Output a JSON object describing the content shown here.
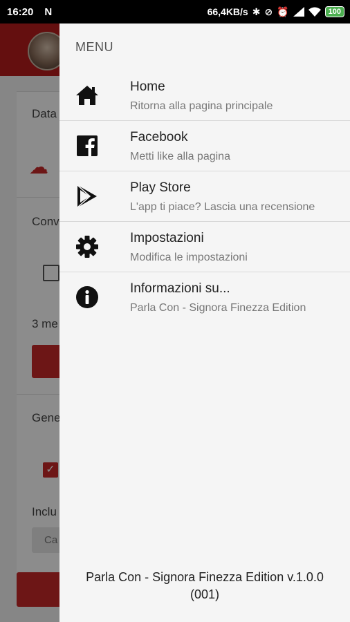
{
  "status_bar": {
    "time": "16:20",
    "notification_icon": "N",
    "speed": "66,4KB/s",
    "battery": "100"
  },
  "drawer": {
    "title": "MENU",
    "items": [
      {
        "icon": "home-icon",
        "title": "Home",
        "subtitle": "Ritorna alla pagina principale"
      },
      {
        "icon": "facebook-icon",
        "title": "Facebook",
        "subtitle": "Metti like alla pagina"
      },
      {
        "icon": "play-store-icon",
        "title": "Play Store",
        "subtitle": "L'app ti piace? Lascia una recensione"
      },
      {
        "icon": "gear-icon",
        "title": "Impostazioni",
        "subtitle": "Modifica le impostazioni"
      },
      {
        "icon": "info-icon",
        "title": "Informazioni su...",
        "subtitle": "Parla Con - Signora Finezza Edition"
      }
    ],
    "footer_line1": "Parla Con - Signora Finezza Edition v.1.0.0",
    "footer_line2": "(001)"
  },
  "background_app": {
    "label_data": "Data",
    "label_conv": "Conv",
    "label_3me": "3 me",
    "label_gene": "Gene",
    "label_inclu": "Inclu",
    "chip_text": "Ca"
  }
}
